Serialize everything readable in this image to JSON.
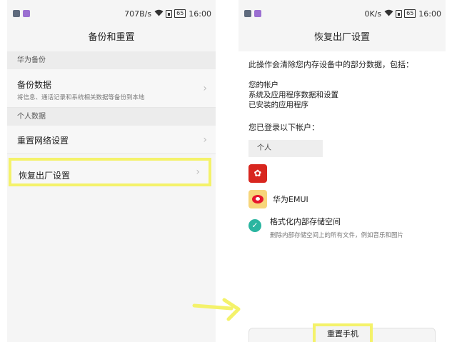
{
  "left": {
    "status": {
      "speed": "707B/s",
      "battery": "65",
      "time": "16:00"
    },
    "title": "备份和重置",
    "sections": [
      {
        "header": "华为备份"
      },
      {
        "header": "个人数据"
      }
    ],
    "items": [
      {
        "title": "备份数据",
        "subtitle": "将信息、通话记录和系统相关数据等备份到本地"
      },
      {
        "title": "重置网络设置"
      },
      {
        "title": "恢复出厂设置"
      }
    ]
  },
  "right": {
    "status": {
      "speed": "0K/s",
      "battery": "65",
      "time": "16:00"
    },
    "title": "恢复出厂设置",
    "warning": "此操作会清除您内存设备中的部分数据，包括：",
    "bullets": [
      "您的帐户",
      "系统及应用程序数据和设置",
      "已安装的应用程序"
    ],
    "logged_in": "您已登录以下帐户：",
    "personal_chip": "个人",
    "account_name": "华为EMUI",
    "format": {
      "title": "格式化内部存储空间",
      "subtitle": "删除内部存储空间上的所有文件，例如音乐和图片"
    },
    "reset_button": "重置手机"
  },
  "colors": {
    "highlight": "#f4f26a",
    "check": "#2ab5a0",
    "huawei_red": "#d8261f"
  }
}
